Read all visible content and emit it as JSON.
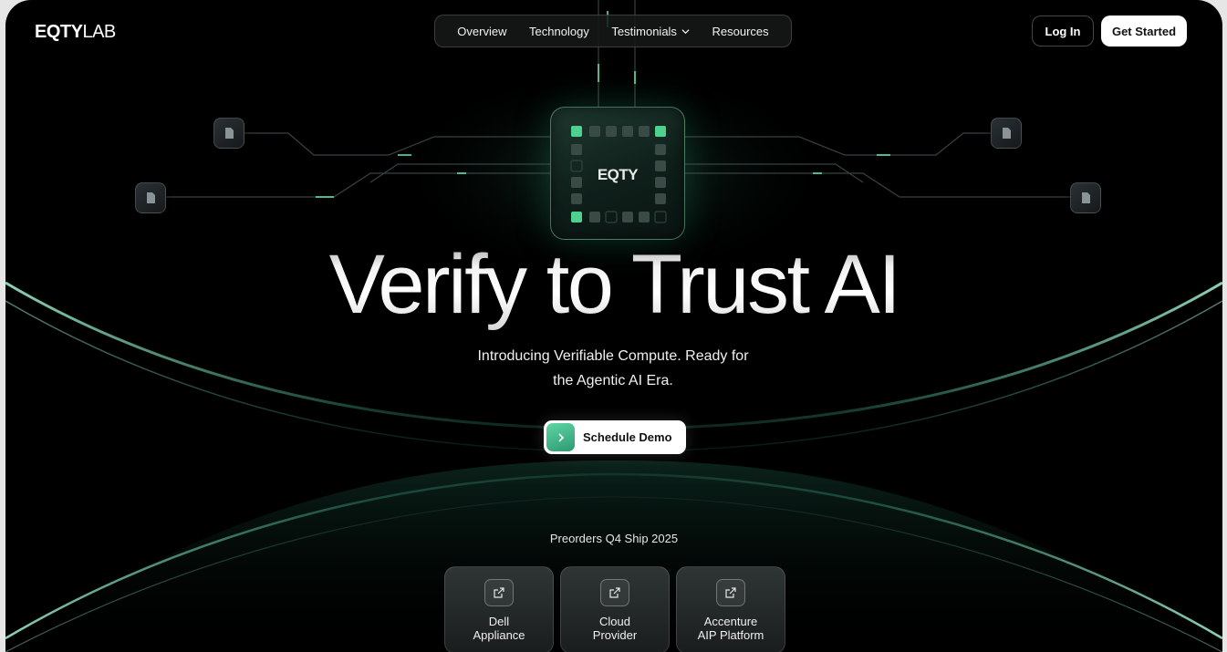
{
  "brand": {
    "logo_bold": "EQTY",
    "logo_light": "LAB"
  },
  "nav": {
    "items": [
      {
        "label": "Overview"
      },
      {
        "label": "Technology"
      },
      {
        "label": "Testimonials",
        "has_dropdown": true
      },
      {
        "label": "Resources"
      }
    ]
  },
  "header": {
    "login_label": "Log In",
    "get_started_label": "Get Started"
  },
  "chip": {
    "label": "EQTY"
  },
  "hero": {
    "title": "Verify to Trust AI",
    "subtitle_line1": "Introducing Verifiable Compute. Ready for",
    "subtitle_line2": "the Agentic AI Era.",
    "cta_label": "Schedule Demo"
  },
  "preorder": {
    "text": "Preorders Q4 Ship 2025",
    "cards": [
      {
        "line1": "Dell",
        "line2": "Appliance",
        "icon": "external-link-icon"
      },
      {
        "line1": "Cloud",
        "line2": "Provider",
        "icon": "external-link-icon"
      },
      {
        "line1": "Accenture",
        "line2": "AIP Platform",
        "icon": "external-link-icon"
      }
    ]
  },
  "colors": {
    "background": "#000000",
    "accent_green": "#3fbf8c",
    "button_white": "#ffffff"
  }
}
